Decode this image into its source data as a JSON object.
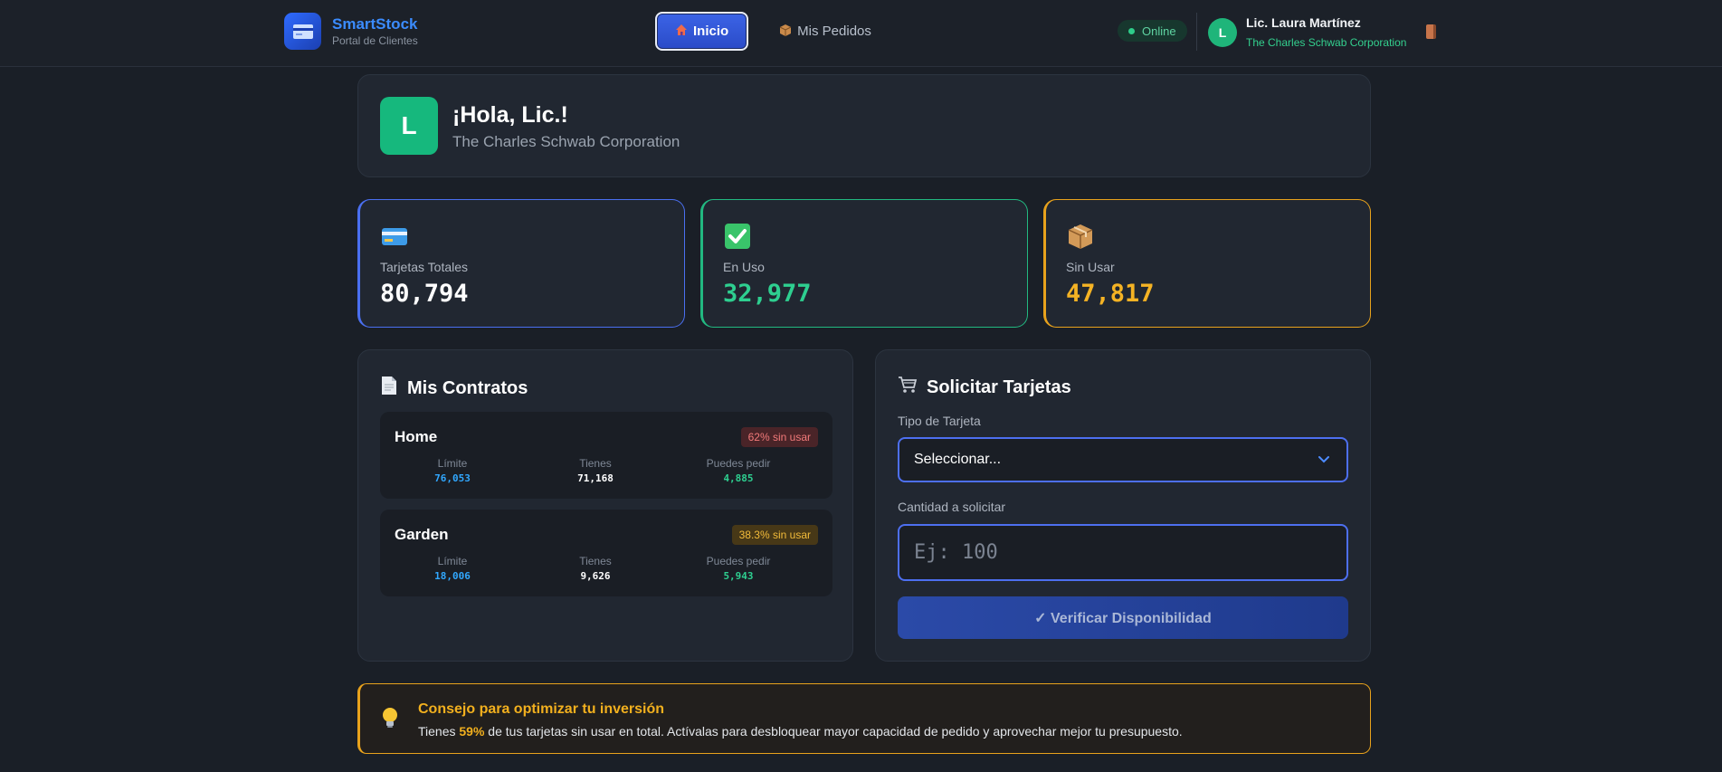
{
  "header": {
    "brand_title": "SmartStock",
    "brand_subtitle": "Portal de Clientes",
    "nav": [
      {
        "icon": "home-icon",
        "label": "Inicio",
        "active": true
      },
      {
        "icon": "package-icon",
        "label": "Mis Pedidos",
        "active": false
      }
    ],
    "status": "Online",
    "user": {
      "initial": "L",
      "name": "Lic. Laura Martínez",
      "company": "The Charles Schwab Corporation"
    }
  },
  "greeting": {
    "initial": "L",
    "title": "¡Hola, Lic.!",
    "subtitle": "The Charles Schwab Corporation"
  },
  "stats": [
    {
      "icon": "credit-card-icon",
      "label": "Tarjetas Totales",
      "value": "80,794",
      "color": "#ffffff"
    },
    {
      "icon": "check-icon",
      "label": "En Uso",
      "value": "32,977",
      "color": "#2ecf90"
    },
    {
      "icon": "box-icon",
      "label": "Sin Usar",
      "value": "47,817",
      "color": "#f5b324"
    }
  ],
  "contracts": {
    "title": "Mis Contratos",
    "items": [
      {
        "name": "Home",
        "badge": "62% sin usar",
        "badge_level": "red",
        "limit_label": "Límite",
        "limit": "76,053",
        "have_label": "Tienes",
        "have": "71,168",
        "can_label": "Puedes pedir",
        "can": "4,885"
      },
      {
        "name": "Garden",
        "badge": "38.3% sin usar",
        "badge_level": "yellow",
        "limit_label": "Límite",
        "limit": "18,006",
        "have_label": "Tienes",
        "have": "9,626",
        "can_label": "Puedes pedir",
        "can": "5,943"
      }
    ]
  },
  "request": {
    "title": "Solicitar Tarjetas",
    "type_label": "Tipo de Tarjeta",
    "type_value": "Seleccionar...",
    "qty_label": "Cantidad a solicitar",
    "qty_placeholder": "Ej: 100",
    "verify_label": "✓ Verificar Disponibilidad"
  },
  "tip": {
    "title": "Consejo para optimizar tu inversión",
    "text_before": "Tienes ",
    "percent": "59%",
    "text_after": " de tus tarjetas sin usar en total. Actívalas para desbloquear mayor capacidad de pedido y aprovechar mejor tu presupuesto."
  },
  "colors": {
    "accent": "#4a6ff0",
    "success": "#22b981",
    "warning": "#e8a21c",
    "limit_value": "#31a8ff",
    "can_value": "#2ecf90"
  }
}
